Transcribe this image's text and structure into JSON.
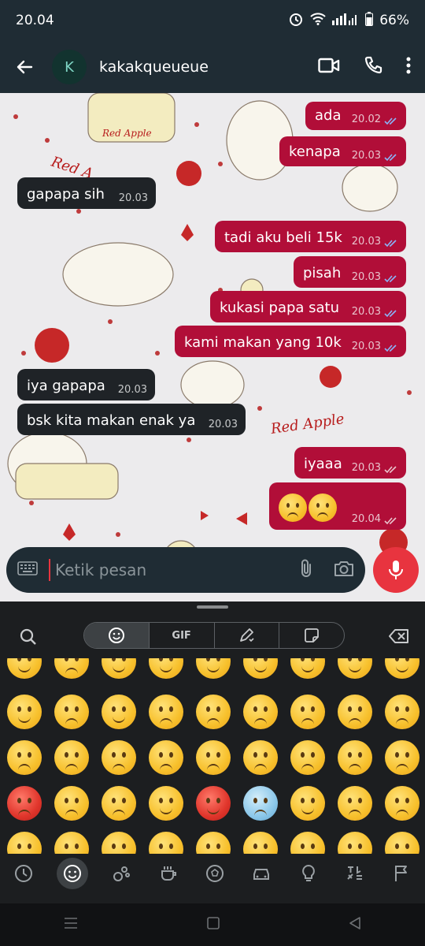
{
  "status": {
    "time": "20.04",
    "battery": "66%"
  },
  "header": {
    "avatar_letter": "K",
    "contact_name": "kakakqueueue"
  },
  "messages": [
    {
      "dir": "out",
      "text": "ada",
      "time": "20.02",
      "read": true
    },
    {
      "dir": "out",
      "text": "kenapa",
      "time": "20.03",
      "read": true
    },
    {
      "dir": "in",
      "text": "gapapa sih",
      "time": "20.03"
    },
    {
      "dir": "out",
      "text": "tadi aku beli 15k",
      "time": "20.03",
      "read": true
    },
    {
      "dir": "out",
      "text": "pisah",
      "time": "20.03",
      "read": true
    },
    {
      "dir": "out",
      "text": "kukasi papa satu",
      "time": "20.03",
      "read": true
    },
    {
      "dir": "out",
      "text": "kami makan yang 10k",
      "time": "20.03",
      "read": true
    },
    {
      "dir": "in",
      "text": "iya gapapa",
      "time": "20.03"
    },
    {
      "dir": "in",
      "text": "bsk kita makan enak ya",
      "time": "20.03"
    },
    {
      "dir": "out",
      "text": "iyaaa",
      "time": "20.03",
      "read": false
    },
    {
      "dir": "out",
      "text": "",
      "emoji": "frowning-face x2",
      "time": "20.04",
      "read": false
    }
  ],
  "wallpaper": {
    "labels": [
      "Red Apple",
      "Red A",
      "Red Apple"
    ]
  },
  "composer": {
    "placeholder": "Ketik pesan"
  },
  "keyboard": {
    "tabs": [
      {
        "id": "emoji",
        "icon": "smiley-icon",
        "active": true
      },
      {
        "id": "gif",
        "label": "GIF"
      },
      {
        "id": "sticker-create",
        "icon": "pen-icon"
      },
      {
        "id": "sticker",
        "icon": "sticker-icon"
      }
    ],
    "categories": [
      "recent-icon",
      "smileys-icon",
      "animals-icon",
      "food-icon",
      "sports-icon",
      "travel-icon",
      "objects-icon",
      "symbols-icon",
      "flags-icon"
    ]
  },
  "colors": {
    "outgoing": "#b10e38",
    "incoming": "#1f2327",
    "header": "#1f2c34",
    "mic": "#e8343f"
  }
}
